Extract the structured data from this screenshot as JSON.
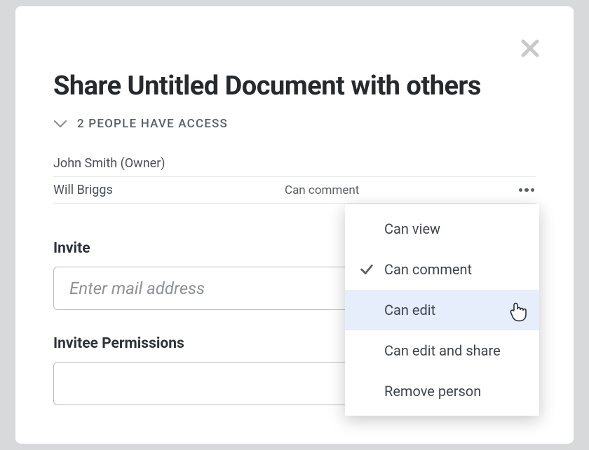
{
  "dialog": {
    "title": "Share Untitled Document with others",
    "access_summary": "2 PEOPLE HAVE ACCESS"
  },
  "people": [
    {
      "name": "John Smith (Owner)",
      "permission": ""
    },
    {
      "name": "Will Briggs",
      "permission": "Can comment"
    }
  ],
  "invite": {
    "label": "Invite",
    "placeholder": "Enter mail address"
  },
  "invitee_permissions": {
    "label": "Invitee Permissions"
  },
  "permission_menu": {
    "options": [
      {
        "label": "Can view",
        "selected": false,
        "highlighted": false
      },
      {
        "label": "Can comment",
        "selected": true,
        "highlighted": false
      },
      {
        "label": "Can edit",
        "selected": false,
        "highlighted": true
      },
      {
        "label": "Can edit and share",
        "selected": false,
        "highlighted": false
      },
      {
        "label": "Remove person",
        "selected": false,
        "highlighted": false
      }
    ]
  }
}
